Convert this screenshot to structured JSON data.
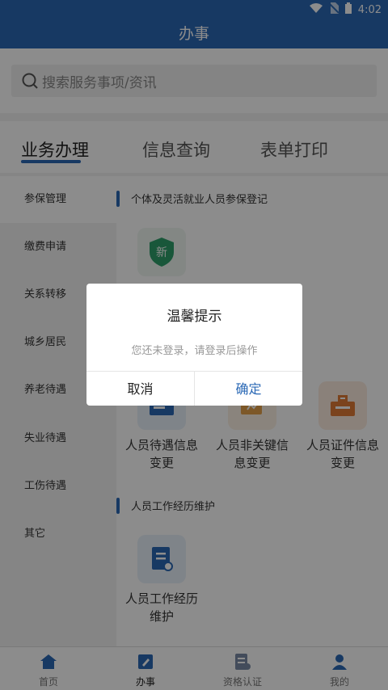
{
  "status_bar": {
    "time": "4:02"
  },
  "header": {
    "title": "办事"
  },
  "search": {
    "placeholder": "搜索服务事项/资讯"
  },
  "tabs": [
    {
      "label": "业务办理",
      "active": true
    },
    {
      "label": "信息查询",
      "active": false
    },
    {
      "label": "表单打印",
      "active": false
    }
  ],
  "sidebar": {
    "items": [
      {
        "label": "参保管理",
        "active": true
      },
      {
        "label": "缴费申请"
      },
      {
        "label": "关系转移"
      },
      {
        "label": "城乡居民"
      },
      {
        "label": "养老待遇"
      },
      {
        "label": "失业待遇"
      },
      {
        "label": "工伤待遇"
      },
      {
        "label": "其它"
      }
    ]
  },
  "main": {
    "section1": {
      "title": "个体及灵活就业人员参保登记",
      "new_badge": "新"
    },
    "services": [
      {
        "label_line1": "人员待遇信息",
        "label_line2": "变更",
        "icon": "id-card-icon",
        "color": "#2a68b5"
      },
      {
        "label_line1": "人员非关键信",
        "label_line2": "息变更",
        "icon": "edit-form-icon",
        "color": "#e3a14a"
      },
      {
        "label_line1": "人员证件信息",
        "label_line2": "变更",
        "icon": "certificate-icon",
        "color": "#e07a36"
      }
    ],
    "section2": {
      "title": "人员工作经历维护",
      "service": {
        "label_line1": "人员工作经历",
        "label_line2": "维护",
        "icon": "document-icon"
      }
    }
  },
  "tabbar": [
    {
      "label": "首页",
      "icon": "home-icon"
    },
    {
      "label": "办事",
      "icon": "edit-icon",
      "active": true
    },
    {
      "label": "资格认证",
      "icon": "certification-icon"
    },
    {
      "label": "我的",
      "icon": "user-icon"
    }
  ],
  "dialog": {
    "title": "温馨提示",
    "message": "您还未登录，请登录后操作",
    "cancel_label": "取消",
    "confirm_label": "确定"
  },
  "colors": {
    "primary": "#2a68b5",
    "green": "#2e9e6a",
    "orange": "#e07a36"
  }
}
